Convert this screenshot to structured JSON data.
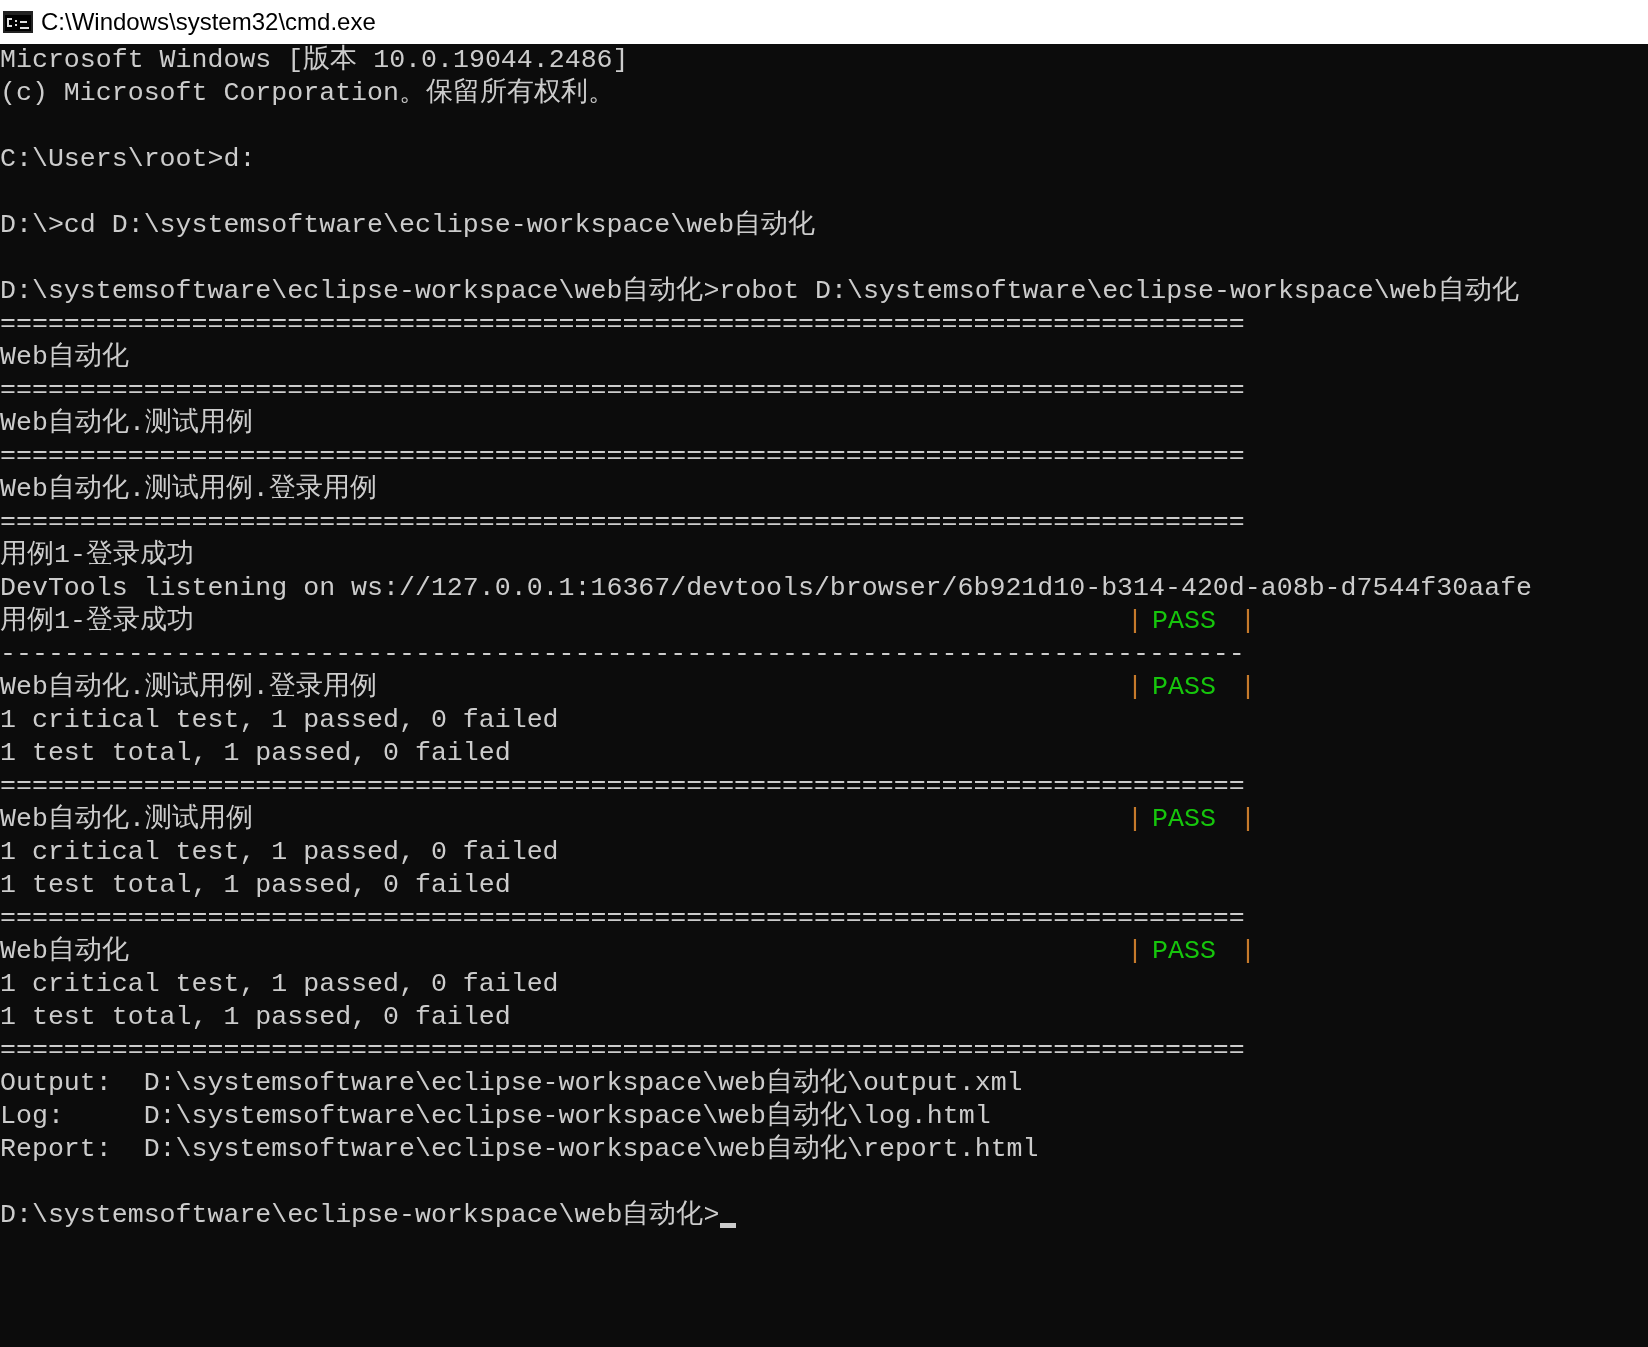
{
  "window": {
    "title": "C:\\Windows\\system32\\cmd.exe"
  },
  "console": {
    "lines": [
      {
        "kind": "text",
        "text": "Microsoft Windows [版本 10.0.19044.2486]"
      },
      {
        "kind": "text",
        "text": "(c) Microsoft Corporation。保留所有权利。"
      },
      {
        "kind": "blank"
      },
      {
        "kind": "text",
        "text": "C:\\Users\\root>d:"
      },
      {
        "kind": "blank"
      },
      {
        "kind": "text",
        "text": "D:\\>cd D:\\systemsoftware\\eclipse-workspace\\web自动化"
      },
      {
        "kind": "blank"
      },
      {
        "kind": "text",
        "text": "D:\\systemsoftware\\eclipse-workspace\\web自动化>robot D:\\systemsoftware\\eclipse-workspace\\web自动化"
      },
      {
        "kind": "text",
        "text": "=============================================================================="
      },
      {
        "kind": "text",
        "text": "Web自动化"
      },
      {
        "kind": "text",
        "text": "=============================================================================="
      },
      {
        "kind": "text",
        "text": "Web自动化.测试用例"
      },
      {
        "kind": "text",
        "text": "=============================================================================="
      },
      {
        "kind": "text",
        "text": "Web自动化.测试用例.登录用例"
      },
      {
        "kind": "text",
        "text": "=============================================================================="
      },
      {
        "kind": "text",
        "text": "用例1-登录成功"
      },
      {
        "kind": "text",
        "text": "DevTools listening on ws://127.0.0.1:16367/devtools/browser/6b921d10-b314-420d-a08b-d7544f30aafe"
      },
      {
        "kind": "status",
        "text": "用例1-登录成功",
        "open": "|",
        "label": "PASS",
        "close": "|",
        "passed": true
      },
      {
        "kind": "text",
        "text": "------------------------------------------------------------------------------"
      },
      {
        "kind": "status",
        "text": "Web自动化.测试用例.登录用例",
        "open": "|",
        "label": "PASS",
        "close": "|",
        "passed": true
      },
      {
        "kind": "text",
        "text": "1 critical test, 1 passed, 0 failed"
      },
      {
        "kind": "text",
        "text": "1 test total, 1 passed, 0 failed"
      },
      {
        "kind": "text",
        "text": "=============================================================================="
      },
      {
        "kind": "status",
        "text": "Web自动化.测试用例",
        "open": "|",
        "label": "PASS",
        "close": "|",
        "passed": true
      },
      {
        "kind": "text",
        "text": "1 critical test, 1 passed, 0 failed"
      },
      {
        "kind": "text",
        "text": "1 test total, 1 passed, 0 failed"
      },
      {
        "kind": "text",
        "text": "=============================================================================="
      },
      {
        "kind": "status",
        "text": "Web自动化",
        "open": "|",
        "label": "PASS",
        "close": "|",
        "passed": true
      },
      {
        "kind": "text",
        "text": "1 critical test, 1 passed, 0 failed"
      },
      {
        "kind": "text",
        "text": "1 test total, 1 passed, 0 failed"
      },
      {
        "kind": "text",
        "text": "=============================================================================="
      },
      {
        "kind": "text",
        "text": "Output:  D:\\systemsoftware\\eclipse-workspace\\web自动化\\output.xml"
      },
      {
        "kind": "text",
        "text": "Log:     D:\\systemsoftware\\eclipse-workspace\\web自动化\\log.html"
      },
      {
        "kind": "text",
        "text": "Report:  D:\\systemsoftware\\eclipse-workspace\\web自动化\\report.html"
      },
      {
        "kind": "blank"
      },
      {
        "kind": "prompt",
        "text": "D:\\systemsoftware\\eclipse-workspace\\web自动化>"
      }
    ]
  }
}
